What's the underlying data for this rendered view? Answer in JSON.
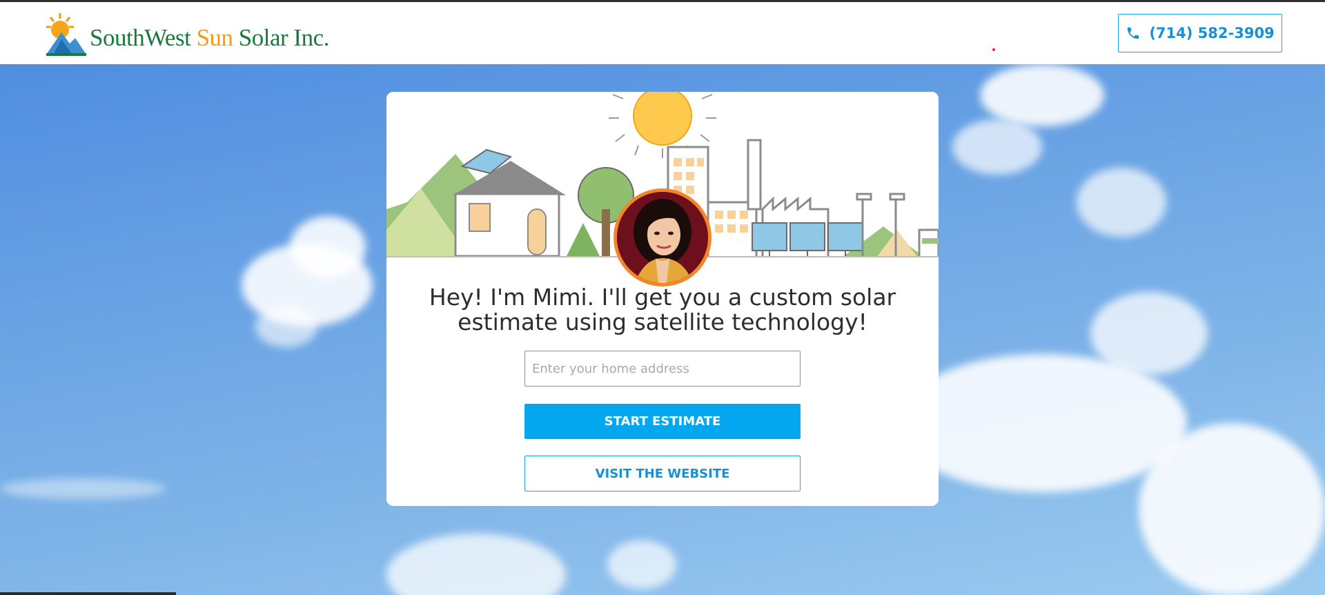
{
  "header": {
    "logo_text_1": "SouthWest ",
    "logo_text_sun": "Sun",
    "logo_text_2": " Solar Inc.",
    "phone_icon": "phone-icon",
    "phone_label": "(714) 582-3909"
  },
  "card": {
    "headline": "Hey! I'm Mimi. I'll get you a custom solar estimate using satellite technology!",
    "address_placeholder": "Enter your home address",
    "address_value": "",
    "start_label": "START ESTIMATE",
    "visit_label": "VISIT THE WEBSITE"
  },
  "colors": {
    "accent": "#03a7ef",
    "accent_text": "#1691d6",
    "avatar_ring": "#f3862a",
    "logo_green": "#167a3c",
    "logo_orange": "#f39a12"
  }
}
